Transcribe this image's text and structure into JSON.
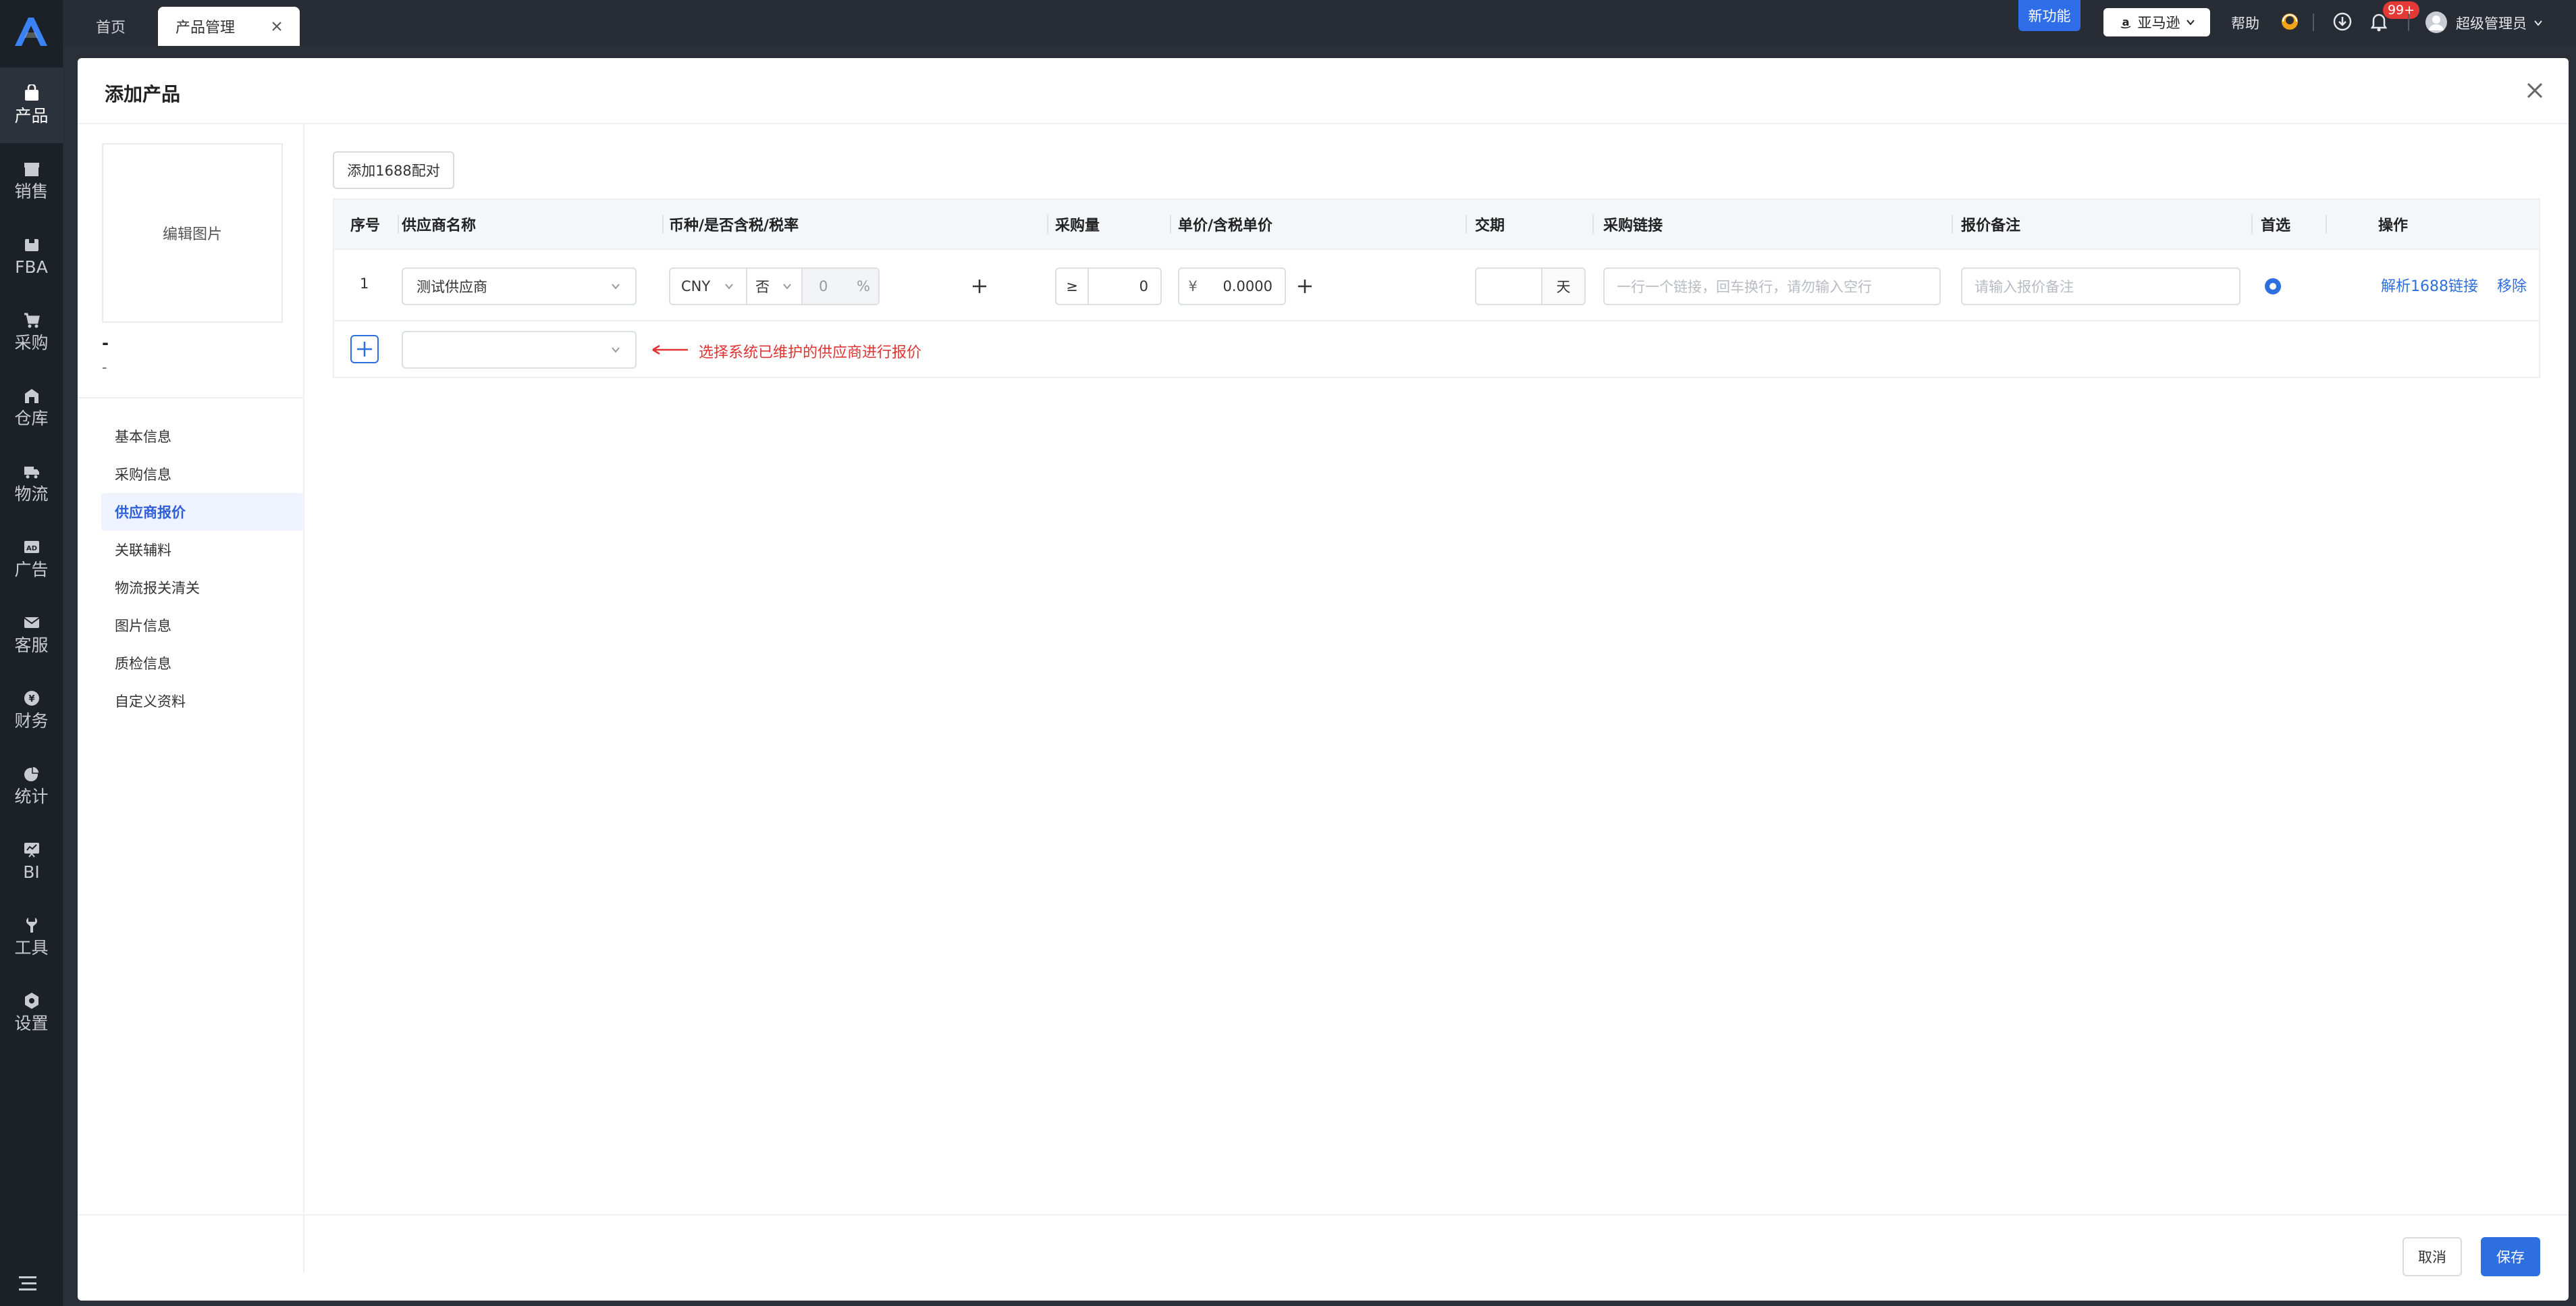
{
  "topbar": {
    "tabs": [
      {
        "label": "首页"
      },
      {
        "label": "产品管理"
      }
    ],
    "new_feature_badge": "新功能",
    "marketplace": "亚马逊",
    "help": "帮助",
    "notification_count": "99+",
    "user": "超级管理员"
  },
  "sidebar": {
    "items": [
      {
        "label": "产品",
        "icon": "bag-icon"
      },
      {
        "label": "销售",
        "icon": "store-icon"
      },
      {
        "label": "FBA",
        "icon": "box-icon"
      },
      {
        "label": "采购",
        "icon": "cart-icon"
      },
      {
        "label": "仓库",
        "icon": "warehouse-icon"
      },
      {
        "label": "物流",
        "icon": "truck-icon"
      },
      {
        "label": "广告",
        "icon": "ad-icon"
      },
      {
        "label": "客服",
        "icon": "mail-icon"
      },
      {
        "label": "财务",
        "icon": "yen-icon"
      },
      {
        "label": "统计",
        "icon": "pie-icon"
      },
      {
        "label": "BI",
        "icon": "chart-icon"
      },
      {
        "label": "工具",
        "icon": "wrench-icon"
      },
      {
        "label": "设置",
        "icon": "gear-icon"
      }
    ]
  },
  "modal": {
    "title": "添加产品",
    "edit_image": "编辑图片",
    "product_name": "-",
    "product_sku": "-",
    "menu": [
      "基本信息",
      "采购信息",
      "供应商报价",
      "关联辅料",
      "物流报关清关",
      "图片信息",
      "质检信息",
      "自定义资料"
    ],
    "add_1688_button": "添加1688配对",
    "columns": [
      "序号",
      "供应商名称",
      "币种/是否含税/税率",
      "采购量",
      "单价/含税单价",
      "交期",
      "采购链接",
      "报价备注",
      "首选",
      "操作"
    ],
    "row": {
      "index": "1",
      "supplier": "测试供应商",
      "currency": "CNY",
      "tax_included": "否",
      "tax_rate": "0",
      "percent": "%",
      "qty_prefix": "≥",
      "qty": "0",
      "price_prefix": "¥",
      "price": "0.0000",
      "lead_unit": "天",
      "link_placeholder": "一行一个链接，回车换行，请勿输入空行",
      "remark_placeholder": "请输入报价备注",
      "action_parse": "解析1688链接",
      "action_remove": "移除"
    },
    "hint": "选择系统已维护的供应商进行报价",
    "cancel": "取消",
    "save": "保存"
  },
  "colors": {
    "accent": "#2e6fe0",
    "sidebar_bg": "#1c2127",
    "hint_red": "#e03333"
  }
}
